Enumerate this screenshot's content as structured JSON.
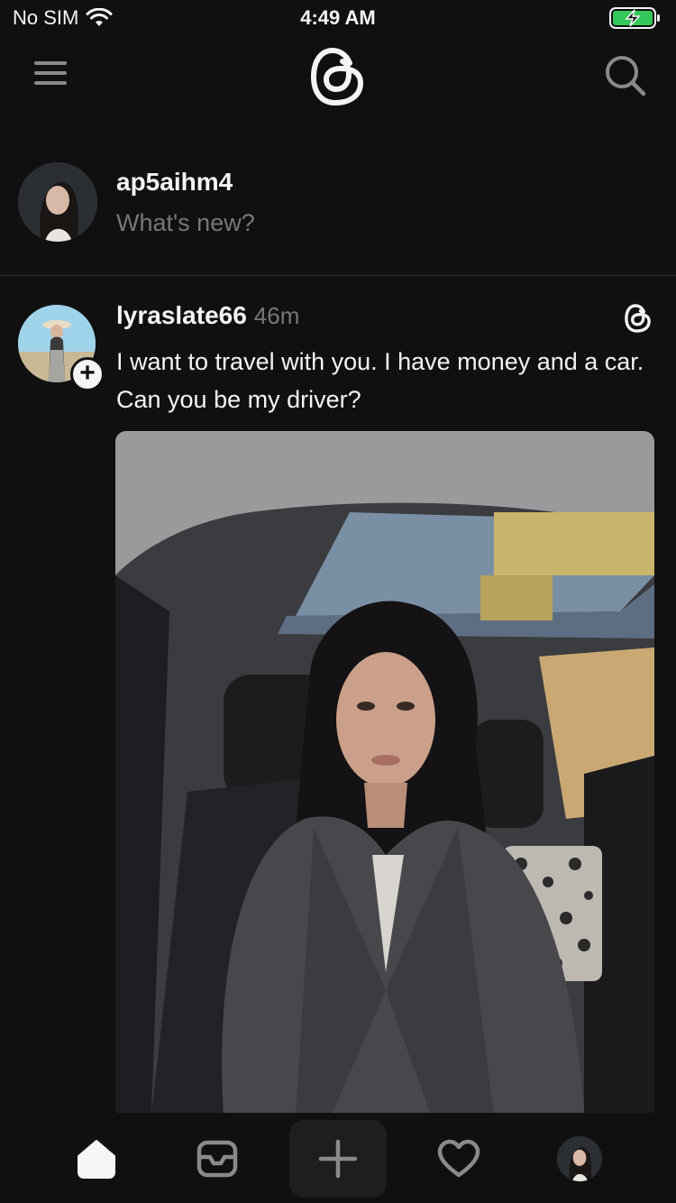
{
  "status_bar": {
    "carrier": "No SIM",
    "time": "4:49 AM"
  },
  "top_nav": {
    "menu_icon": "menu-icon",
    "logo_icon": "threads-logo-icon",
    "search_icon": "search-icon"
  },
  "composer": {
    "username": "ap5aihm4",
    "placeholder": "What's new?"
  },
  "post": {
    "username": "lyraslate66",
    "time": "46m",
    "text": "I want to travel with you. I have money and a car. Can you be my driver?",
    "follow_symbol": "+"
  },
  "tab_bar": {
    "items": [
      {
        "name": "home",
        "icon": "home-icon",
        "active": true
      },
      {
        "name": "messages",
        "icon": "inbox-icon"
      },
      {
        "name": "create",
        "icon": "plus-icon"
      },
      {
        "name": "activity",
        "icon": "heart-icon"
      },
      {
        "name": "profile",
        "icon": "avatar"
      }
    ]
  },
  "colors": {
    "background": "#101010",
    "text": "#f3f5f7",
    "secondary": "#777777",
    "divider": "#2a2a2a"
  }
}
